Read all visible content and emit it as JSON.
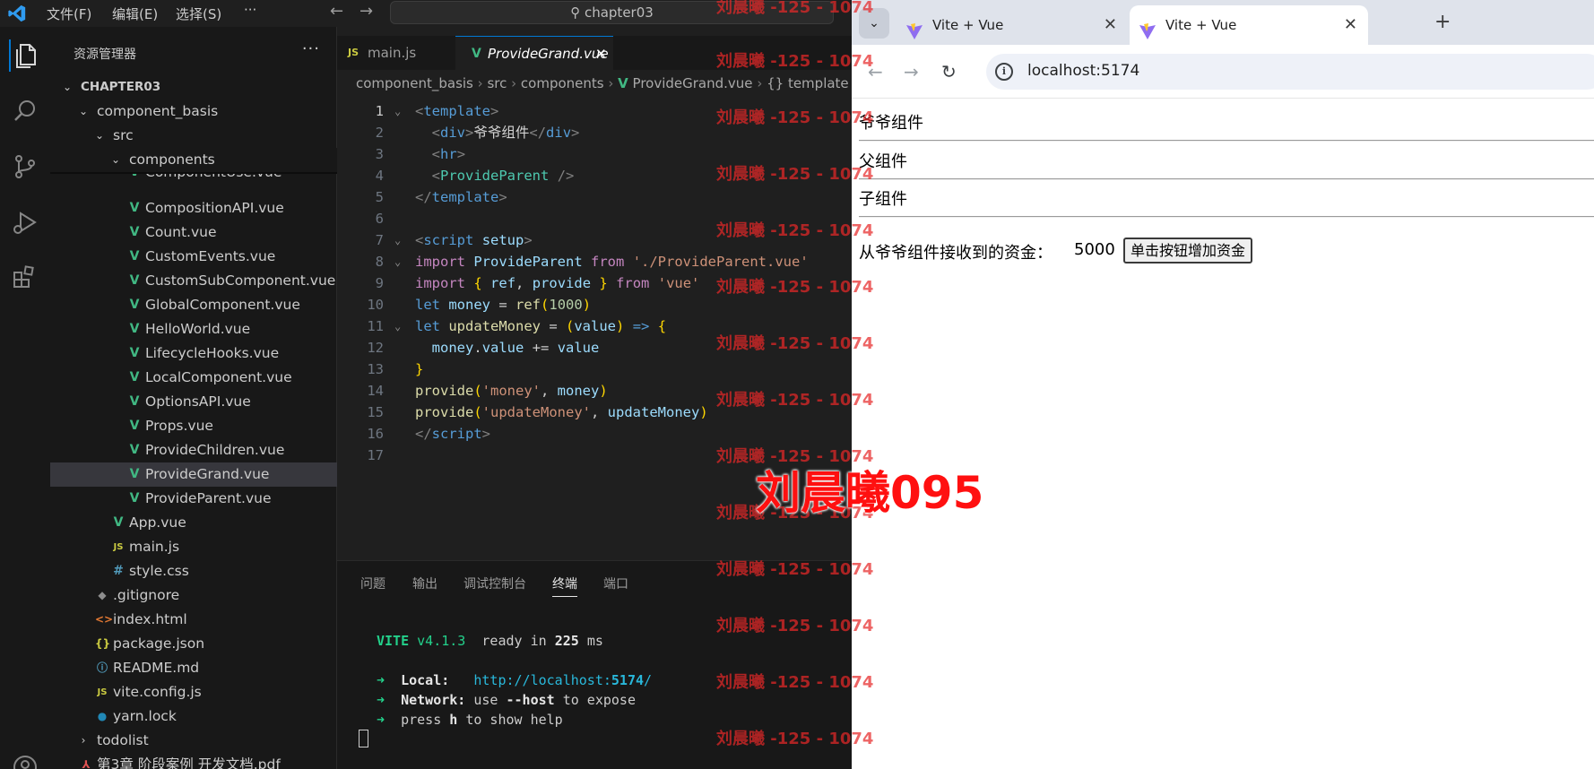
{
  "titlebar": {
    "menu": [
      "文件(F)",
      "编辑(E)",
      "选择(S)",
      "···"
    ],
    "search_text": "chapter03"
  },
  "explorer": {
    "title": "资源管理器",
    "more": "···",
    "rows": [
      {
        "name": "CHAPTER03",
        "kind": "folder-open",
        "bold": true,
        "depth": 0
      },
      {
        "name": "component_basis",
        "kind": "folder-open",
        "depth": 1
      },
      {
        "name": "src",
        "kind": "folder-open",
        "depth": 2
      },
      {
        "name": "components",
        "kind": "folder-open",
        "depth": 3
      },
      {
        "name": "ComponentUse.vue",
        "kind": "vue",
        "depth": 4
      },
      {
        "name": "CompositionAPI.vue",
        "kind": "vue",
        "depth": 4
      },
      {
        "name": "Count.vue",
        "kind": "vue",
        "depth": 4
      },
      {
        "name": "CustomEvents.vue",
        "kind": "vue",
        "depth": 4
      },
      {
        "name": "CustomSubComponent.vue",
        "kind": "vue",
        "depth": 4
      },
      {
        "name": "GlobalComponent.vue",
        "kind": "vue",
        "depth": 4
      },
      {
        "name": "HelloWorld.vue",
        "kind": "vue",
        "depth": 4
      },
      {
        "name": "LifecycleHooks.vue",
        "kind": "vue",
        "depth": 4
      },
      {
        "name": "LocalComponent.vue",
        "kind": "vue",
        "depth": 4
      },
      {
        "name": "OptionsAPI.vue",
        "kind": "vue",
        "depth": 4
      },
      {
        "name": "Props.vue",
        "kind": "vue",
        "depth": 4
      },
      {
        "name": "ProvideChildren.vue",
        "kind": "vue",
        "depth": 4
      },
      {
        "name": "ProvideGrand.vue",
        "kind": "vue",
        "depth": 4,
        "selected": true
      },
      {
        "name": "ProvideParent.vue",
        "kind": "vue",
        "depth": 4
      },
      {
        "name": "App.vue",
        "kind": "vue",
        "depth": 3
      },
      {
        "name": "main.js",
        "kind": "js",
        "depth": 3
      },
      {
        "name": "style.css",
        "kind": "css",
        "depth": 3
      },
      {
        "name": ".gitignore",
        "kind": "git",
        "depth": 2
      },
      {
        "name": "index.html",
        "kind": "html",
        "depth": 2
      },
      {
        "name": "package.json",
        "kind": "json",
        "depth": 2
      },
      {
        "name": "README.md",
        "kind": "info",
        "depth": 2
      },
      {
        "name": "vite.config.js",
        "kind": "js",
        "depth": 2
      },
      {
        "name": "yarn.lock",
        "kind": "yarn",
        "depth": 2
      },
      {
        "name": "todolist",
        "kind": "folder-closed",
        "depth": 1
      },
      {
        "name": "第3章 阶段案例 开发文档.pdf",
        "kind": "pdf",
        "depth": 1
      }
    ]
  },
  "editor": {
    "tabs": [
      {
        "label": "main.js",
        "icon": "JS"
      },
      {
        "label": "ProvideGrand.vue",
        "icon": "V",
        "close": "✕"
      }
    ],
    "breadcrumb": [
      "component_basis",
      "src",
      "components",
      "ProvideGrand.vue",
      "{} template"
    ],
    "line_numbers": [
      "1",
      "2",
      "3",
      "4",
      "5",
      "6",
      "7",
      "8",
      "9",
      "10",
      "11",
      "12",
      "13",
      "14",
      "15",
      "16",
      "17"
    ]
  },
  "panel": {
    "tabs": [
      "问题",
      "输出",
      "调试控制台",
      "终端",
      "端口"
    ],
    "active_tab": "终端",
    "vite_label": "VITE",
    "vite_version": "v4.1.3",
    "ready_text": "ready in",
    "ready_ms": "225",
    "ms_unit": "ms",
    "arrow": "➜",
    "local_label": "Local:",
    "local_url_prefix": "http://localhost:",
    "local_url_port": "5174",
    "local_url_suffix": "/",
    "network_label": "Network:",
    "network_use": "use",
    "network_flag": "--host",
    "network_rest": "to expose",
    "press_text": "press",
    "press_key": "h",
    "press_rest": "to show help"
  },
  "browser": {
    "tabs": [
      {
        "label": "Vite + Vue",
        "close": "✕"
      },
      {
        "label": "Vite + Vue",
        "close": "✕"
      }
    ],
    "new_tab": "+",
    "url": "localhost:5174",
    "page": {
      "grand_label": "爷爷组件",
      "parent_label": "父组件",
      "child_label": "子组件",
      "money_label": "从爷爷组件接收到的资金：",
      "money_value": "5000",
      "button_label": "单击按钮增加资金"
    }
  },
  "watermark": {
    "repeat_text": "刘晨曦 -125 - 1074",
    "big_text": "刘晨曦095"
  },
  "colors": {
    "vue_green": "#41b883",
    "accent_blue": "#0078d4",
    "watermark_red": "#ff1010"
  }
}
